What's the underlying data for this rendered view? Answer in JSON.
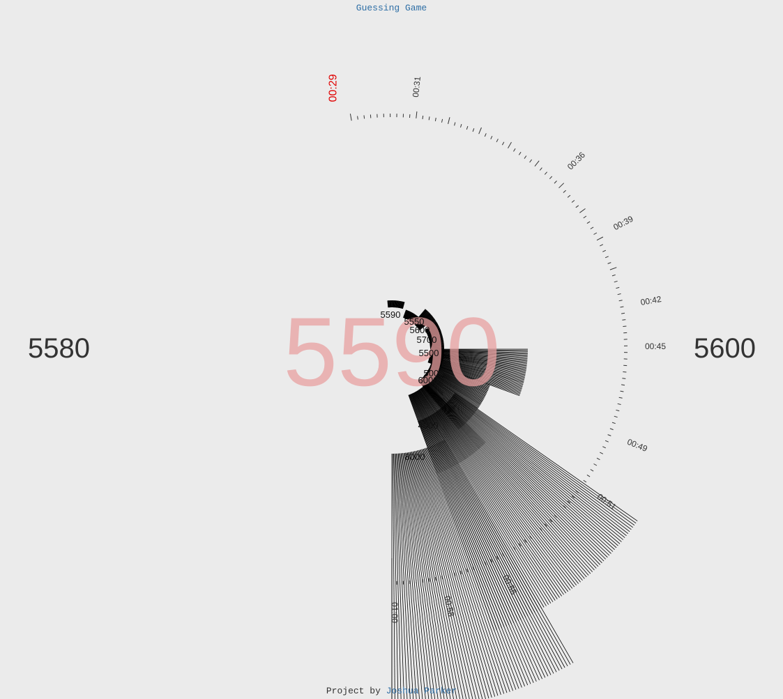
{
  "header": {
    "title_link": "Guessing Game"
  },
  "range": {
    "low": "5580",
    "high": "5600"
  },
  "guess": {
    "value": "5590",
    "color": "#e8a0a0"
  },
  "timer": {
    "current_label": "00:29",
    "current_color": "#e00000",
    "labels": [
      "00:31",
      "00:36",
      "00:39",
      "00:42",
      "00:45",
      "00:49",
      "00:51",
      "00:55",
      "00:58",
      "01:00"
    ]
  },
  "guesses": [
    "5590",
    "5550",
    "5600",
    "5700",
    "5500",
    "5000",
    "6000",
    "4000",
    "8000"
  ],
  "footer": {
    "prefix": "Project by ",
    "author": "Joshua Parker"
  }
}
